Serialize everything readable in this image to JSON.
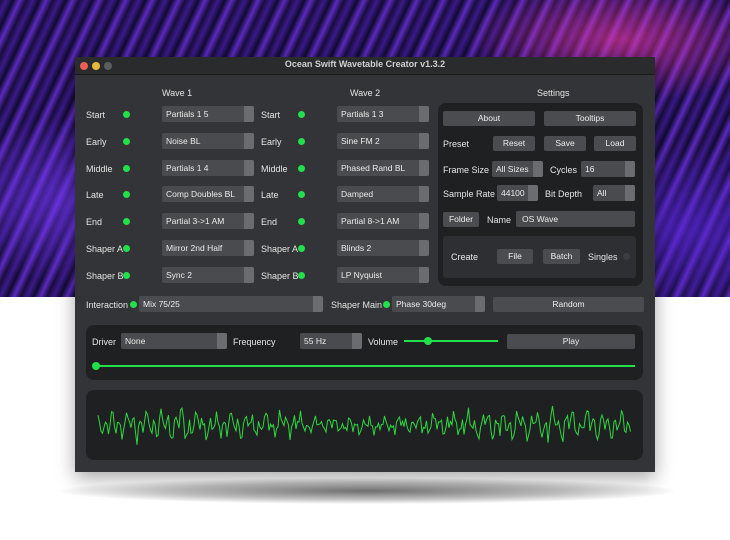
{
  "window": {
    "title": "Ocean Swift Wavetable Creator v1.3.2"
  },
  "wave1": {
    "header": "Wave 1",
    "rows": [
      {
        "label": "Start",
        "value": "Partials 1 5"
      },
      {
        "label": "Early",
        "value": "Noise BL"
      },
      {
        "label": "Middle",
        "value": "Partials 1 4"
      },
      {
        "label": "Late",
        "value": "Comp Doubles BL"
      },
      {
        "label": "End",
        "value": "Partial 3->1 AM"
      },
      {
        "label": "Shaper A",
        "value": "Mirror 2nd Half"
      },
      {
        "label": "Shaper B",
        "value": "Sync 2"
      }
    ]
  },
  "wave2": {
    "header": "Wave 2",
    "rows": [
      {
        "label": "Start",
        "value": "Partials 1 3"
      },
      {
        "label": "Early",
        "value": "Sine FM 2"
      },
      {
        "label": "Middle",
        "value": "Phased Rand BL"
      },
      {
        "label": "Late",
        "value": "Damped"
      },
      {
        "label": "End",
        "value": "Partial 8->1 AM"
      },
      {
        "label": "Shaper A",
        "value": "Blinds 2"
      },
      {
        "label": "Shaper B",
        "value": "LP Nyquist"
      }
    ]
  },
  "settings": {
    "header": "Settings",
    "about_label": "About",
    "tooltips_label": "Tooltips",
    "preset_label": "Preset",
    "reset_label": "Reset",
    "save_label": "Save",
    "load_label": "Load",
    "frame_size_label": "Frame Size",
    "frame_size_value": "All Sizes",
    "cycles_label": "Cycles",
    "cycles_value": "16",
    "sample_rate_label": "Sample Rate",
    "sample_rate_value": "44100",
    "bit_depth_label": "Bit Depth",
    "bit_depth_value": "All",
    "folder_label": "Folder",
    "name_label": "Name",
    "name_value": "OS Wave",
    "create_label": "Create",
    "file_label": "File",
    "batch_label": "Batch",
    "singles_label": "Singles"
  },
  "interaction": {
    "label": "Interaction",
    "value": "Mix 75/25",
    "shaper_main_label": "Shaper Main",
    "shaper_main_value": "Phase 30deg",
    "random_label": "Random"
  },
  "playback": {
    "driver_label": "Driver",
    "driver_value": "None",
    "frequency_label": "Frequency",
    "frequency_value": "55 Hz",
    "volume_label": "Volume",
    "volume_level": 0.25,
    "play_label": "Play",
    "position_level": 0.0
  },
  "colors": {
    "accent_green": "#22e04a",
    "waveform": "#2fd83f",
    "window_bg": "#323437",
    "panel_bg": "#1f2022"
  }
}
